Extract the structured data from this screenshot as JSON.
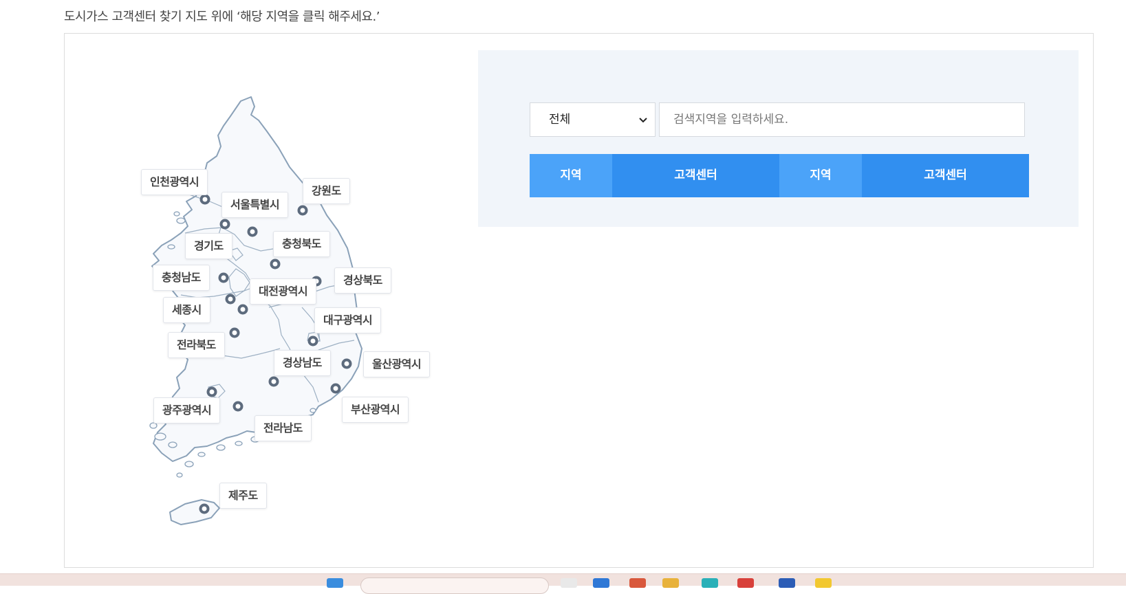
{
  "instruction": "도시가스 고객센터 찾기 지도 위에 ‘해당 지역을 클릭 해주세요.’",
  "map": {
    "regions": [
      {
        "id": "incheon",
        "label": "인천광역시"
      },
      {
        "id": "seoul",
        "label": "서울특별시"
      },
      {
        "id": "gangwon",
        "label": "강원도"
      },
      {
        "id": "gyeonggi",
        "label": "경기도"
      },
      {
        "id": "chungbuk",
        "label": "충청북도"
      },
      {
        "id": "chungnam",
        "label": "충청남도"
      },
      {
        "id": "daejeon",
        "label": "대전광역시"
      },
      {
        "id": "gyeongbuk",
        "label": "경상북도"
      },
      {
        "id": "sejong",
        "label": "세종시"
      },
      {
        "id": "daegu",
        "label": "대구광역시"
      },
      {
        "id": "jeonbuk",
        "label": "전라북도"
      },
      {
        "id": "gyeongnam",
        "label": "경상남도"
      },
      {
        "id": "ulsan",
        "label": "울산광역시"
      },
      {
        "id": "gwangju",
        "label": "광주광역시"
      },
      {
        "id": "busan",
        "label": "부산광역시"
      },
      {
        "id": "jeonnam",
        "label": "전라남도"
      },
      {
        "id": "jeju",
        "label": "제주도"
      }
    ]
  },
  "search": {
    "select_value": "전체",
    "input_placeholder": "검색지역을 입력하세요."
  },
  "table": {
    "headers": [
      "지역",
      "고객센터",
      "지역",
      "고객센터"
    ]
  },
  "colors": {
    "panel_bg": "#f1f5fa",
    "header_region": "#4ba3f9",
    "header_center": "#318ff0",
    "map_outline": "#8aa1b8",
    "marker": "#5d6b7d"
  }
}
